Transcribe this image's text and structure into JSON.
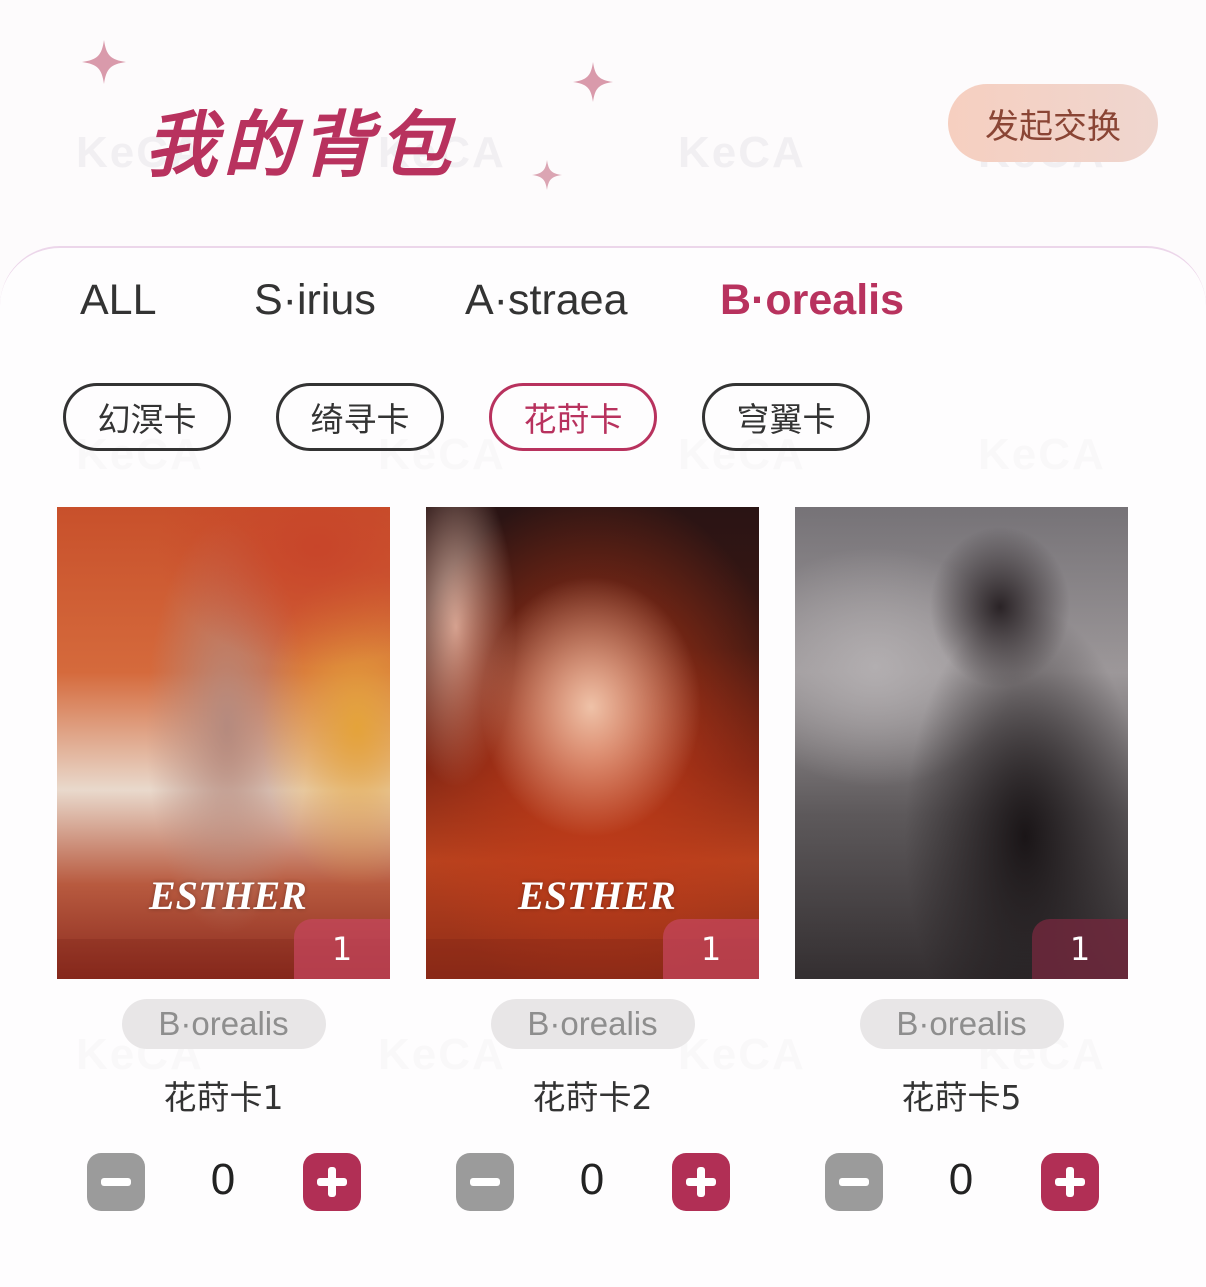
{
  "header": {
    "title": "我的背包",
    "exchange_button": "发起交换"
  },
  "tabs": [
    {
      "label": "ALL",
      "active": false
    },
    {
      "label": "S·irius",
      "active": false
    },
    {
      "label": "A·straea",
      "active": false
    },
    {
      "label": "B·orealis",
      "active": true
    }
  ],
  "chips": [
    {
      "label": "幻溟卡",
      "active": false
    },
    {
      "label": "绮寻卡",
      "active": false
    },
    {
      "label": "花莳卡",
      "active": true
    },
    {
      "label": "穹翼卡",
      "active": false
    }
  ],
  "cards": [
    {
      "name": "花莳卡1",
      "series": "B·orealis",
      "owned": "1",
      "selected": "0",
      "image_text": "ESTHER"
    },
    {
      "name": "花莳卡2",
      "series": "B·orealis",
      "owned": "1",
      "selected": "0",
      "image_text": "ESTHER"
    },
    {
      "name": "花莳卡5",
      "series": "B·orealis",
      "owned": "1",
      "selected": "0"
    }
  ],
  "watermark": "KeCA",
  "colors": {
    "accent": "#b8325e",
    "plus_button": "#b12f55",
    "minus_button": "#9b9b9b",
    "exchange_button": "#f6cfc0"
  }
}
